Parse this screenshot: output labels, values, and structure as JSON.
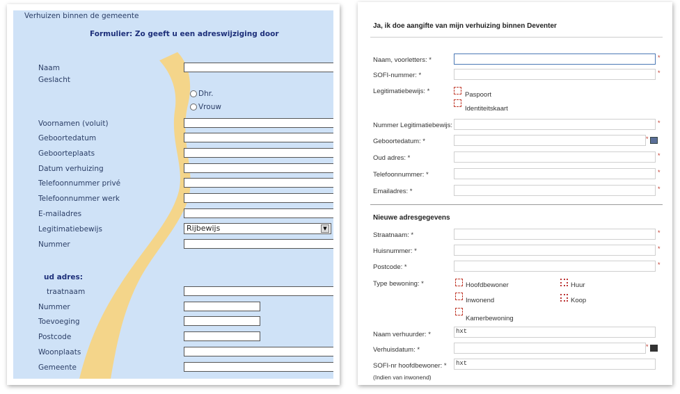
{
  "left_form": {
    "top_title": "Verhuizen binnen de gemeente",
    "heading": "Formulier: Zo geeft u een adreswijziging door",
    "labels": {
      "naam": "Naam",
      "geslacht": "Geslacht",
      "voornamen": "Voornamen (voluit)",
      "geboortedatum": "Geboortedatum",
      "geboorteplaats": "Geboorteplaats",
      "datum_verhuizing": "Datum verhuizing",
      "tel_prive": "Telefoonnummer privé",
      "tel_werk": "Telefoonnummer werk",
      "email": "E-mailadres",
      "legitimatie": "Legitimatiebewijs",
      "nummer": "Nummer"
    },
    "radio_dhr": "Dhr.",
    "radio_vrouw": "Vrouw",
    "legitimatie_selected": "Rijbewijs",
    "oud_adres_heading": "ud adres:",
    "oud_labels": {
      "straatnaam": "traatnaam",
      "nummer": "Nummer",
      "toevoeging": "Toevoeging",
      "postcode": "Postcode",
      "woonplaats": "Woonplaats",
      "gemeente": "Gemeente"
    }
  },
  "right_form": {
    "heading": "Ja, ik doe aangifte van mijn verhuizing binnen Deventer",
    "labels": {
      "naam": "Naam, voorletters: *",
      "sofi": "SOFI-nummer: *",
      "legitimatie": "Legitimatiebewijs: *",
      "nummer_legit": "Nummer Legitimatiebewijs: *",
      "geboortedatum": "Geboortedatum: *",
      "oud_adres": "Oud adres: *",
      "telefoon": "Telefoonnummer: *",
      "email": "Emailadres: *"
    },
    "legit_options": [
      "Paspoort",
      "Identiteitskaart"
    ],
    "nieuwe_heading": "Nieuwe adresgegevens",
    "nieuwe_labels": {
      "straatnaam": "Straatnaam: *",
      "huisnummer": "Huisnummer: *",
      "postcode": "Postcode: *",
      "type": "Type bewoning: *",
      "naam_verhuurder": "Naam verhuurder: *",
      "verhuisdatum": "Verhuisdatum: *",
      "sofi_hoofd": "SOFI-nr hoofdbewoner: *",
      "inwonend_note": "(Indien van inwonend)"
    },
    "type_options": {
      "hoofdbewoner": "Hoofdbewoner",
      "inwonend": "Inwonend",
      "kamerbewoning": "Kamerbewoning",
      "huur": "Huur",
      "koop": "Koop"
    },
    "placeholder_hxt": "hxt",
    "required_mark": "*"
  },
  "colors": {
    "left_background": "#cfe2f7",
    "sand_path": "#f4d58a",
    "left_heading": "#1d2f7a",
    "required": "#c0392b"
  }
}
